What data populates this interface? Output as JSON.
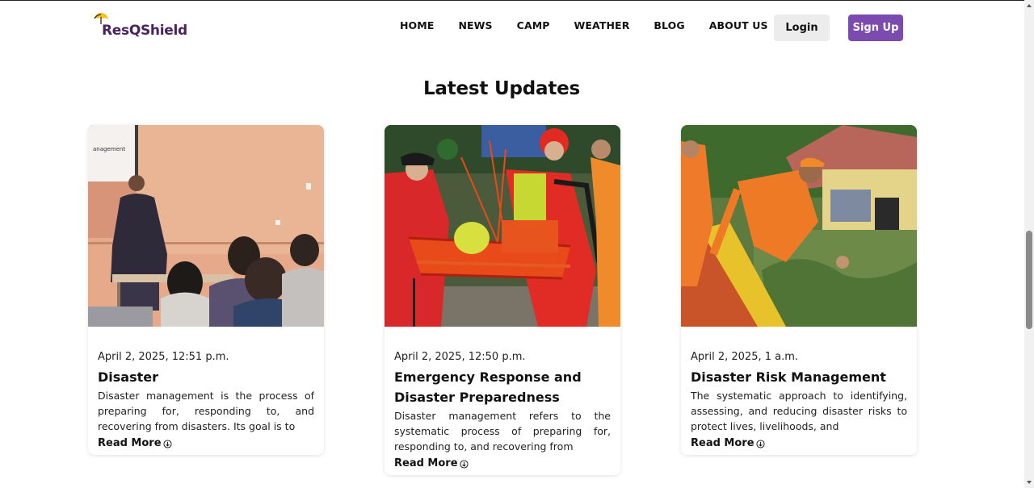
{
  "brand": {
    "name": "ResQShield",
    "accent": "#4a2260",
    "icon": "umbrella-logo-icon"
  },
  "nav": {
    "links": [
      "HOME",
      "NEWS",
      "CAMP",
      "WEATHER",
      "BLOG",
      "ABOUT US"
    ],
    "login_label": "Login",
    "signup_label": "Sign Up",
    "signup_color": "#7b4bb0"
  },
  "section": {
    "title": "Latest Updates"
  },
  "cards": [
    {
      "date": "April 2, 2025, 12:51 p.m.",
      "title": "Disaster",
      "description": "Disaster management is the process of preparing for, responding to, and recovering from disasters. Its goal is to",
      "read_more": "Read More",
      "image": "presentation-room-photo"
    },
    {
      "date": "April 2, 2025, 12:50 p.m.",
      "title": "Emergency Response and Disaster Preparedness",
      "description": "Disaster management refers to the systematic process of preparing for, responding to, and recovering from",
      "read_more": "Read More",
      "image": "rescue-stretcher-photo"
    },
    {
      "date": "April 2, 2025, 1 a.m.",
      "title": "Disaster Risk Management",
      "description": "The systematic approach to identifying, assessing, and reducing disaster risks to protect lives, livelihoods, and",
      "read_more": "Read More",
      "image": "flood-rescue-photo"
    }
  ]
}
